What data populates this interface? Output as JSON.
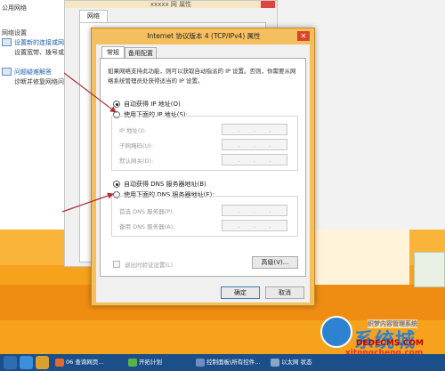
{
  "left_window": {
    "items": [
      {
        "label": "公用网络",
        "link": false
      },
      {
        "label": "网络设置",
        "link": false
      },
      {
        "label": "设置新的连接或网络",
        "link": true
      },
      {
        "label": "设置宽带、拨号或 VPN",
        "link": false
      },
      {
        "label": "问题疑难解答",
        "link": true
      },
      {
        "label": "诊断并修复网络问题",
        "link": false
      }
    ]
  },
  "bg_window": {
    "title": "xxxxx 网 属性",
    "tab_label": "网络"
  },
  "dialog": {
    "title": "Internet 协议版本 4 (TCP/IPv4) 属性",
    "close_glyph": "✕",
    "tabs": [
      "常规",
      "备用配置"
    ],
    "description": "如果网络支持此功能，则可以获取自动指派的 IP 设置。否则，你需要从网络系统管理员处获得适当的 IP 设置。",
    "ip_auto_label": "自动获得 IP 地址(O)",
    "ip_manual_label": "使用下面的 IP 地址(S):",
    "ip_fields": [
      "IP 地址(I):",
      "子网掩码(U):",
      "默认网关(D):"
    ],
    "dns_auto_label": "自动获得 DNS 服务器地址(B)",
    "dns_manual_label": "使用下面的 DNS 服务器地址(E):",
    "dns_fields": [
      "首选 DNS 服务器(P):",
      "备用 DNS 服务器(A):"
    ],
    "ip_dot": ".",
    "validate_label": "退出时验证设置(L)",
    "advanced_button": "高级(V)...",
    "ok_button": "确定",
    "cancel_button": "取消"
  },
  "watermark": {
    "brand": "系统城",
    "site": "xitongcheng.com",
    "overlay_code": "织梦内容管理系统",
    "overlay_site": "DEDECMS.COM"
  },
  "taskbar": {
    "items": [
      "06 查询网页...",
      "开拓计划",
      "控制面板\\所有控件...",
      "以太网 状态"
    ]
  },
  "colors": {
    "dialog_frame": "#f4bf5e",
    "taskbar": "#1c4f8a",
    "wallpaper": "#f6a21c",
    "arrow": "#b0323a"
  }
}
